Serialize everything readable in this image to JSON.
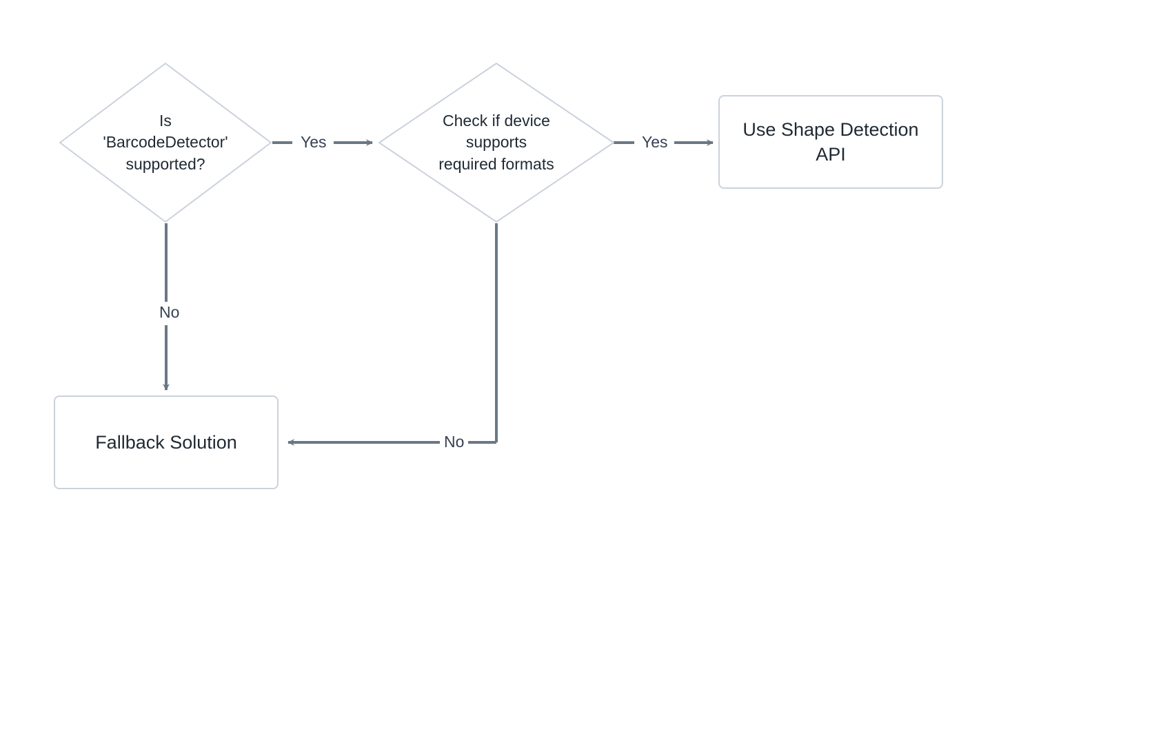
{
  "diagram": {
    "nodes": {
      "decision_barcode": {
        "line1": "Is 'BarcodeDetector'",
        "line2": "supported?"
      },
      "decision_formats": {
        "line1": "Check if device supports",
        "line2": "required formats"
      },
      "result_shape_api": {
        "line1": "Use Shape Detection",
        "line2": "API"
      },
      "result_fallback": "Fallback Solution"
    },
    "edges": {
      "barcode_yes": "Yes",
      "barcode_no": "No",
      "formats_yes": "Yes",
      "formats_no": "No"
    },
    "colors": {
      "node_border": "#cbd2dc",
      "arrow": "#6b7785",
      "text": "#1f2933"
    }
  }
}
